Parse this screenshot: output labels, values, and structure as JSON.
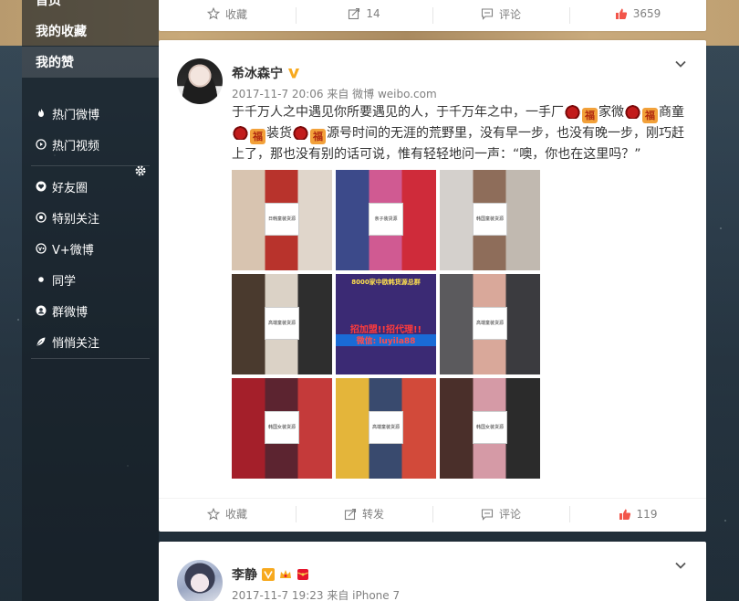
{
  "sidebar": {
    "items": [
      {
        "label": "首页",
        "icon": "none",
        "active": false,
        "top": true
      },
      {
        "label": "我的收藏",
        "icon": "none",
        "active": false,
        "top": true
      },
      {
        "label": "我的赞",
        "icon": "none",
        "active": true,
        "top": true
      },
      {
        "label": "热门微博",
        "icon": "flame-icon"
      },
      {
        "label": "热门视频",
        "icon": "video-icon"
      },
      {
        "label": "好友圈",
        "icon": "heart-circle-icon"
      },
      {
        "label": "特别关注",
        "icon": "eye-icon"
      },
      {
        "label": "V+微博",
        "icon": "vplus-icon"
      },
      {
        "label": "同学",
        "icon": "dot-icon"
      },
      {
        "label": "群微博",
        "icon": "user-circle-icon"
      },
      {
        "label": "悄悄关注",
        "icon": "leaf-icon"
      }
    ]
  },
  "prev_post": {
    "actions": {
      "favorite": "收藏",
      "repost": "14",
      "comment": "评论",
      "like": "3659"
    }
  },
  "post1": {
    "name": "希冰森宁",
    "time": "2017-11-7 20:06",
    "source": "来自 微博 weibo.com",
    "text_parts": {
      "a": "于千万人之中遇见你所要遇见的人，于千万年之中，一手厂",
      "b": "家微",
      "c": "商童",
      "d": "装货",
      "e": "源号时间的无涯的荒野里，没有早一步，也没有晚一步，刚巧赶上了，那也没有别的话可说，惟有轻轻地问一声：“噢，你也在这里吗？”"
    },
    "emoji_fu": "福",
    "images": [
      {
        "label": "日韩童装货源"
      },
      {
        "label": "亲子装货源"
      },
      {
        "label": "韩国童装货源"
      },
      {
        "label": "高端童装货源"
      },
      {
        "label": "ad",
        "ad_title": "8000家中欧韩货源总群",
        "ad_mid": "招加盟!!招代理!!",
        "ad_wx": "微信: luyila88"
      },
      {
        "label": "高端童装货源"
      },
      {
        "label": "韩国女装货源"
      },
      {
        "label": "高端童装货源"
      },
      {
        "label": "韩国女装货源"
      }
    ],
    "actions": {
      "favorite": "收藏",
      "repost": "转发",
      "comment": "评论",
      "like": "119"
    }
  },
  "post2": {
    "name": "李静",
    "time": "2017-11-7 19:23",
    "source": "来自 iPhone 7"
  },
  "colors": {
    "like_red": "#f2554a",
    "verified_orange": "#f7a91e",
    "weibo_red": "#e6162d"
  }
}
